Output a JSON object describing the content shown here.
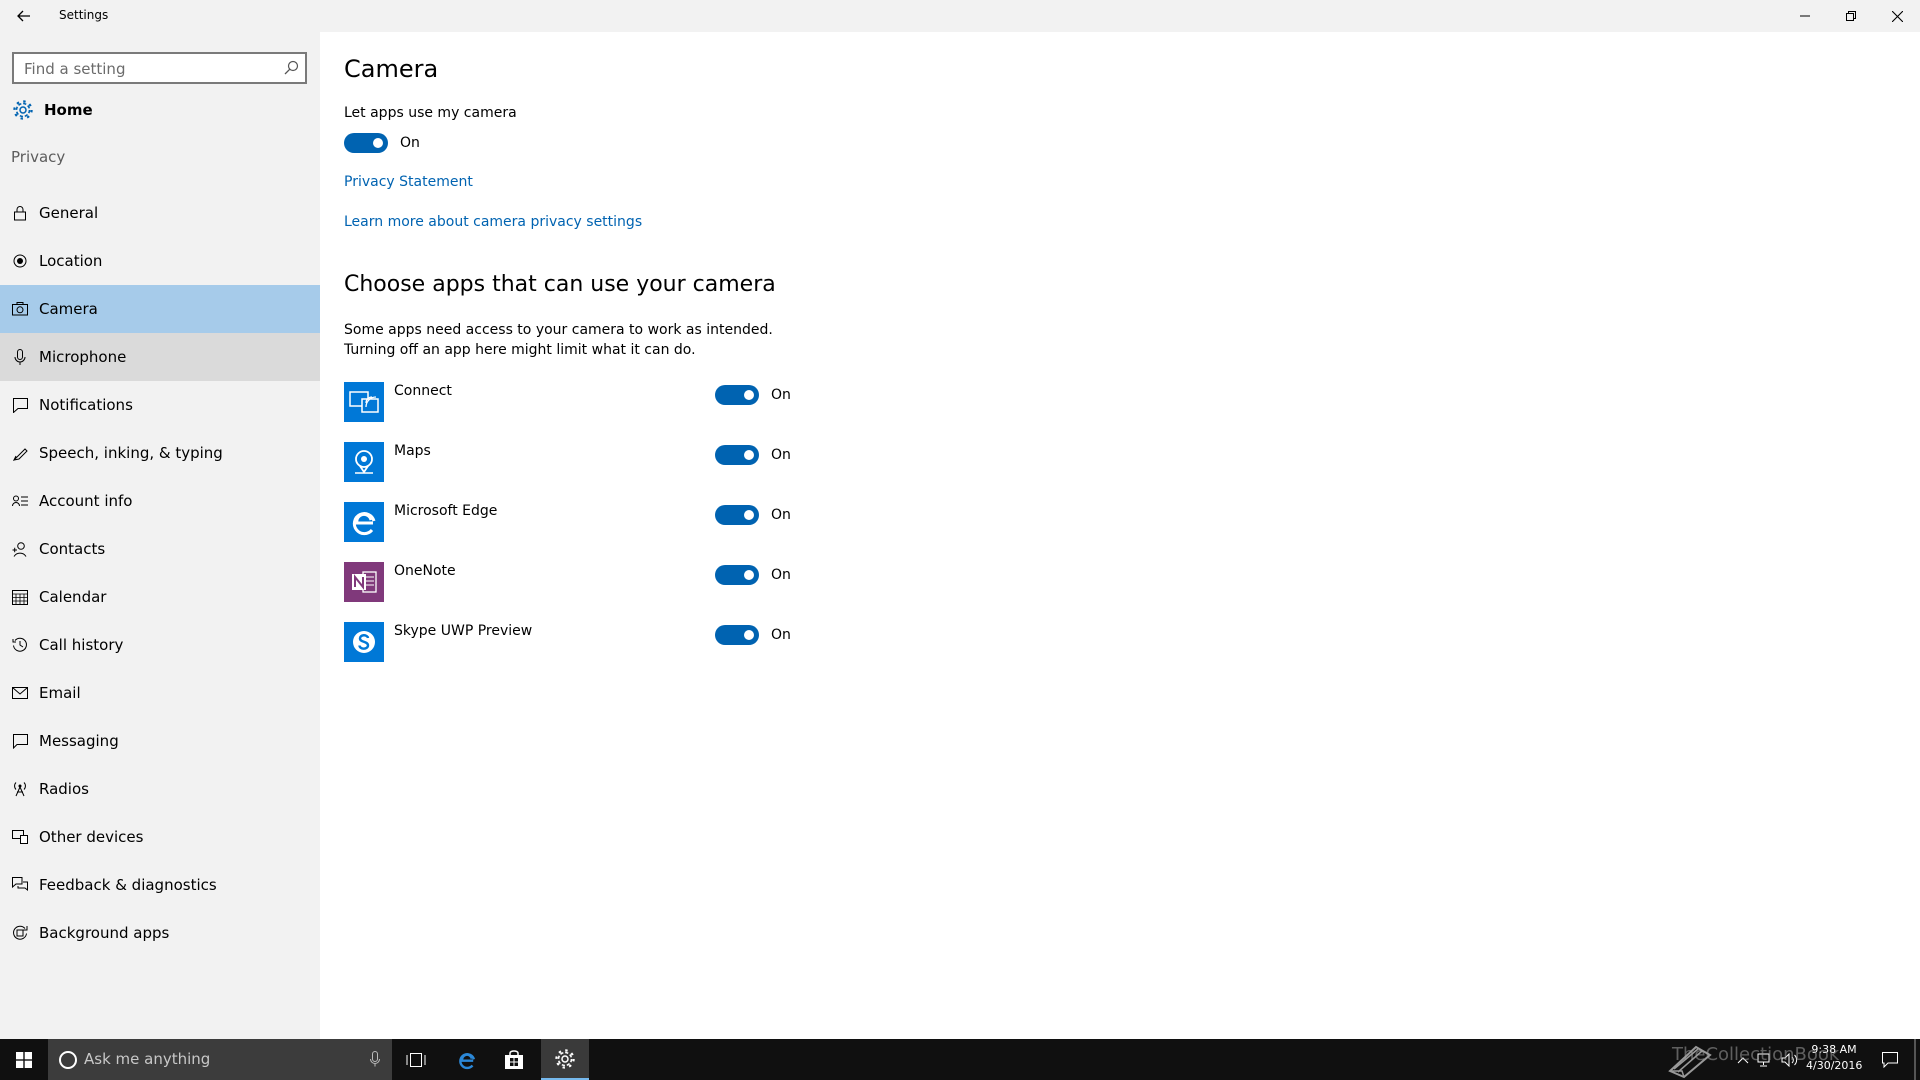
{
  "window": {
    "title": "Settings"
  },
  "sidebar": {
    "search_placeholder": "Find a setting",
    "home_label": "Home",
    "section_label": "Privacy",
    "items": [
      {
        "label": "General",
        "icon": "lock-icon"
      },
      {
        "label": "Location",
        "icon": "location-icon"
      },
      {
        "label": "Camera",
        "icon": "camera-icon"
      },
      {
        "label": "Microphone",
        "icon": "microphone-icon"
      },
      {
        "label": "Notifications",
        "icon": "notifications-icon"
      },
      {
        "label": "Speech, inking, & typing",
        "icon": "speech-icon"
      },
      {
        "label": "Account info",
        "icon": "account-info-icon"
      },
      {
        "label": "Contacts",
        "icon": "contacts-icon"
      },
      {
        "label": "Calendar",
        "icon": "calendar-icon"
      },
      {
        "label": "Call history",
        "icon": "history-icon"
      },
      {
        "label": "Email",
        "icon": "email-icon"
      },
      {
        "label": "Messaging",
        "icon": "messaging-icon"
      },
      {
        "label": "Radios",
        "icon": "radios-icon"
      },
      {
        "label": "Other devices",
        "icon": "other-devices-icon"
      },
      {
        "label": "Feedback & diagnostics",
        "icon": "feedback-icon"
      },
      {
        "label": "Background apps",
        "icon": "background-apps-icon"
      }
    ],
    "selected": "Camera",
    "hovered": "Microphone"
  },
  "main": {
    "title": "Camera",
    "toggle_label": "Let apps use my camera",
    "toggle_state": "On",
    "privacy_link": "Privacy Statement",
    "learn_more_link": "Learn more about camera privacy settings",
    "apps_heading": "Choose apps that can use your camera",
    "apps_desc_line1": "Some apps need access to your camera to work as intended.",
    "apps_desc_line2": "Turning off an app here might limit what it can do.",
    "apps": [
      {
        "name": "Connect",
        "state": "On",
        "color": "#0078d7"
      },
      {
        "name": "Maps",
        "state": "On",
        "color": "#0078d7"
      },
      {
        "name": "Microsoft Edge",
        "state": "On",
        "color": "#0078d7"
      },
      {
        "name": "OneNote",
        "state": "On",
        "color": "#80397b"
      },
      {
        "name": "Skype UWP Preview",
        "state": "On",
        "color": "#0078d7"
      }
    ]
  },
  "taskbar": {
    "search_placeholder": "Ask me anything",
    "time": "9:38 AM",
    "date": "4/30/2016"
  },
  "watermark": "TheCollectionBook",
  "colors": {
    "accent": "#0063b1",
    "selected": "#a6cbea",
    "sidebar_bg": "#f2f2f2"
  }
}
